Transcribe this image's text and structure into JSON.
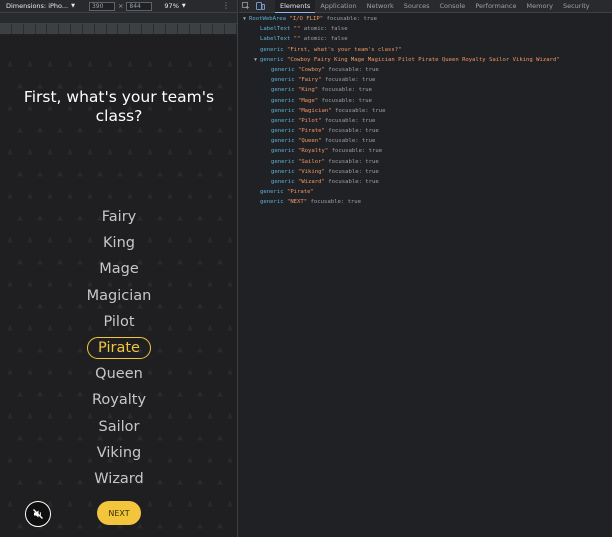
{
  "device_toolbar": {
    "device_label": "Dimensions: iPho...",
    "width": "390",
    "height": "844",
    "zoom": "97%",
    "times": "×"
  },
  "app": {
    "question": "First, what's your team's class?",
    "classes": [
      {
        "label": "Fairy",
        "selected": false
      },
      {
        "label": "King",
        "selected": false
      },
      {
        "label": "Mage",
        "selected": false
      },
      {
        "label": "Magician",
        "selected": false
      },
      {
        "label": "Pilot",
        "selected": false
      },
      {
        "label": "Pirate",
        "selected": true
      },
      {
        "label": "Queen",
        "selected": false
      },
      {
        "label": "Royalty",
        "selected": false
      },
      {
        "label": "Sailor",
        "selected": false
      },
      {
        "label": "Viking",
        "selected": false
      },
      {
        "label": "Wizard",
        "selected": false
      }
    ],
    "next_label": "NEXT",
    "mute_icon": "speaker-muted-icon",
    "colors": {
      "accent": "#f2c53d",
      "background": "#1f1f21"
    }
  },
  "devtools": {
    "tabs": [
      "Elements",
      "Application",
      "Network",
      "Sources",
      "Console",
      "Performance",
      "Memory",
      "Security"
    ],
    "active_tab": "Elements",
    "tree": [
      {
        "indent": 0,
        "arrow": "▼",
        "role": "RootWebArea",
        "name": "\"I/O FLIP\"",
        "props": " focusable: true"
      },
      {
        "indent": 1,
        "arrow": "",
        "role": "LabelText",
        "name": "\"\"",
        "props": " atomic: false"
      },
      {
        "indent": 1,
        "arrow": "",
        "role": "LabelText",
        "name": "\"\"",
        "props": " atomic: false"
      },
      {
        "indent": 1,
        "arrow": "",
        "role": "generic",
        "name": "\"First, what's your team's class?\"",
        "props": ""
      },
      {
        "indent": 1,
        "arrow": "▼",
        "role": "generic",
        "name": "\"Cowboy Fairy King Mage Magician Pilot Pirate Queen Royalty Sailor Viking Wizard\"",
        "props": ""
      },
      {
        "indent": 2,
        "arrow": "",
        "role": "generic",
        "name": "\"Cowboy\"",
        "props": " focusable: true"
      },
      {
        "indent": 2,
        "arrow": "",
        "role": "generic",
        "name": "\"Fairy\"",
        "props": " focusable: true"
      },
      {
        "indent": 2,
        "arrow": "",
        "role": "generic",
        "name": "\"King\"",
        "props": " focusable: true"
      },
      {
        "indent": 2,
        "arrow": "",
        "role": "generic",
        "name": "\"Mage\"",
        "props": " focusable: true"
      },
      {
        "indent": 2,
        "arrow": "",
        "role": "generic",
        "name": "\"Magician\"",
        "props": " focusable: true"
      },
      {
        "indent": 2,
        "arrow": "",
        "role": "generic",
        "name": "\"Pilot\"",
        "props": " focusable: true"
      },
      {
        "indent": 2,
        "arrow": "",
        "role": "generic",
        "name": "\"Pirate\"",
        "props": " focusable: true"
      },
      {
        "indent": 2,
        "arrow": "",
        "role": "generic",
        "name": "\"Queen\"",
        "props": " focusable: true"
      },
      {
        "indent": 2,
        "arrow": "",
        "role": "generic",
        "name": "\"Royalty\"",
        "props": " focusable: true"
      },
      {
        "indent": 2,
        "arrow": "",
        "role": "generic",
        "name": "\"Sailor\"",
        "props": " focusable: true"
      },
      {
        "indent": 2,
        "arrow": "",
        "role": "generic",
        "name": "\"Viking\"",
        "props": " focusable: true"
      },
      {
        "indent": 2,
        "arrow": "",
        "role": "generic",
        "name": "\"Wizard\"",
        "props": " focusable: true"
      },
      {
        "indent": 1,
        "arrow": "",
        "role": "generic",
        "name": "\"Pirate\"",
        "props": ""
      },
      {
        "indent": 1,
        "arrow": "",
        "role": "generic",
        "name": "\"NEXT\"",
        "props": " focusable: true"
      }
    ]
  }
}
